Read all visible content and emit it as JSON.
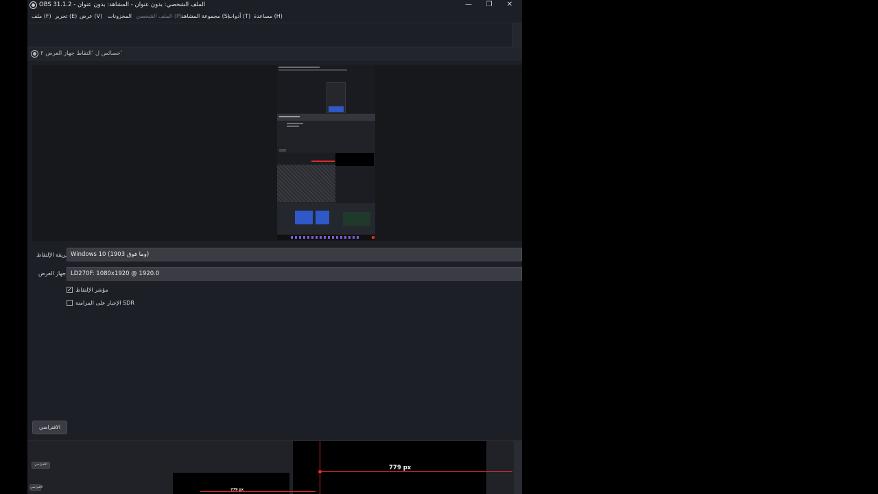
{
  "window": {
    "title": "OBS 31.1.2 - الملف الشخصي: بدون عنوان - المشاهد: بدون عنوان",
    "controls": {
      "minimize": "—",
      "maximize": "❐",
      "close": "✕"
    }
  },
  "menu": {
    "file": "ملف (F)",
    "edit": "تحرير (E)",
    "view": "عرض (V)",
    "docks": "المخزونات",
    "profile": "الملف الشخصي (P)",
    "scene_collection": "مجموعة المشاهد (S)",
    "tools": "أدوات (T)",
    "help": "مساعدة (H)"
  },
  "properties": {
    "header": "خصائص ل 'التقاط جهاز العرض ٢'",
    "capture_method_label": "طريقة الإلتقاط",
    "capture_method_value": "Windows 10 (1903 وما فوق)",
    "display_label": "جهاز العرض",
    "display_value": "LD270F: 1080x1920 @ 1920.0",
    "capture_cursor_label": "مؤشر الإلتقاط",
    "capture_cursor_checked": true,
    "force_sdr_label": "الإجبار على المزامنة SDR",
    "force_sdr_checked": false,
    "defaults_button": "الافتراضي"
  },
  "behind": {
    "px_label_big": "779 px",
    "px_label_small": "779 px",
    "mini_button_1": "الافتراضي",
    "mini_button_2": "الافتراضي"
  },
  "colors": {
    "window_bg": "#1d1f26",
    "combo_bg": "#3b3c43",
    "red_guide": "#e32a2a",
    "selected_blue": "#2f58c8"
  }
}
